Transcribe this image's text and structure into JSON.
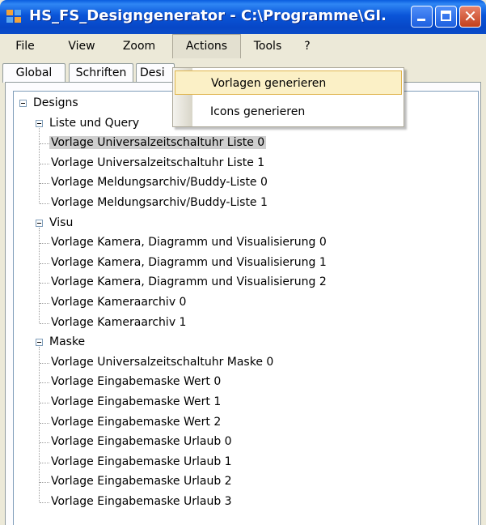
{
  "window": {
    "title": "HS_FS_Designgenerator - C:\\Programme\\GI..."
  },
  "menu": {
    "file": "File",
    "view": "View",
    "zoom": "Zoom",
    "actions": "Actions",
    "tools": "Tools",
    "help": "?"
  },
  "tabs": {
    "global": "Global",
    "schriften": "Schriften",
    "designs": "Desi"
  },
  "actions_menu": {
    "generate_templates": "Vorlagen generieren",
    "generate_icons": "Icons generieren"
  },
  "tree": {
    "root": "Designs",
    "groups": [
      {
        "label": "Liste und Query",
        "items": [
          "Vorlage Universalzeitschaltuhr Liste 0",
          "Vorlage Universalzeitschaltuhr Liste 1",
          "Vorlage Meldungsarchiv/Buddy-Liste 0",
          "Vorlage Meldungsarchiv/Buddy-Liste 1"
        ]
      },
      {
        "label": "Visu",
        "items": [
          "Vorlage Kamera, Diagramm und Visualisierung 0",
          "Vorlage Kamera, Diagramm und Visualisierung 1",
          "Vorlage Kamera, Diagramm und Visualisierung 2",
          "Vorlage Kameraarchiv 0",
          "Vorlage Kameraarchiv 1"
        ]
      },
      {
        "label": "Maske",
        "items": [
          "Vorlage Universalzeitschaltuhr Maske 0",
          "Vorlage Eingabemaske Wert 0",
          "Vorlage Eingabemaske Wert 1",
          "Vorlage Eingabemaske Wert 2",
          "Vorlage Eingabemaske Urlaub 0",
          "Vorlage Eingabemaske Urlaub 1",
          "Vorlage Eingabemaske Urlaub 2",
          "Vorlage Eingabemaske Urlaub 3"
        ]
      }
    ],
    "selected_item": "Vorlage Universalzeitschaltuhr Liste 0"
  },
  "colors": {
    "titlebar": "#0a55d8",
    "selection": "#cfcfcf",
    "menu_hover": "#fbf0c6"
  },
  "icons": [
    "app-icon",
    "minimize-icon",
    "maximize-icon",
    "close-icon",
    "collapse-icon"
  ]
}
